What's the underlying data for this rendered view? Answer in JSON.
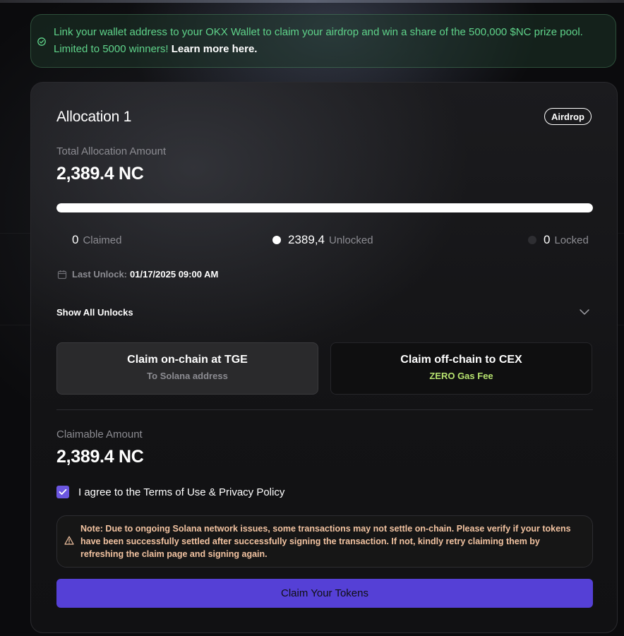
{
  "banner": {
    "message": "Link your wallet address to your OKX Wallet to claim your airdrop and win a share of the 500,000 $NC prize pool. Limited to 5000 winners! ",
    "link_label": "Learn more here."
  },
  "allocation": {
    "title": "Allocation 1",
    "badge": "Airdrop",
    "total_label": "Total Allocation Amount",
    "total_amount": "2,389.4 NC",
    "progress_unlocked_fraction": 1.0
  },
  "stats": {
    "claimed": {
      "value": "0",
      "label": "Claimed"
    },
    "unlocked": {
      "value": "2389,4",
      "label": "Unlocked"
    },
    "locked": {
      "value": "0",
      "label": "Locked"
    }
  },
  "last_unlock": {
    "label": "Last Unlock:",
    "value": "01/17/2025 09:00 AM"
  },
  "show_unlocks_label": "Show All Unlocks",
  "claim_options": [
    {
      "title": "Claim on-chain at TGE",
      "subtitle": "To Solana address",
      "selected": true
    },
    {
      "title": "Claim off-chain to CEX",
      "subtitle": "ZERO Gas Fee",
      "selected": false
    }
  ],
  "claimable": {
    "label": "Claimable Amount",
    "amount": "2,389.4 NC"
  },
  "agreement": {
    "checked": true,
    "text": "I agree to the Terms of Use & Privacy Policy"
  },
  "note": {
    "text": "Note: Due to ongoing Solana network issues, some transactions may not settle on-chain. Please verify if your tokens have been successfully settled after successfully signing the transaction. If not, kindly retry claiming them by refreshing the claim page and signing again."
  },
  "claim_button_label": "Claim Your Tokens",
  "icons": {
    "banner": "check-circle-icon",
    "calendar": "calendar-icon",
    "chevron": "chevron-down-icon",
    "checkbox": "check-icon",
    "note": "warning-triangle-icon"
  },
  "colors": {
    "accent": "#5540d6",
    "checkbox": "#6b56e0",
    "banner_text": "#5fd38a",
    "gas_fee": "#b7e36f",
    "note_text": "#f2c3a1"
  }
}
